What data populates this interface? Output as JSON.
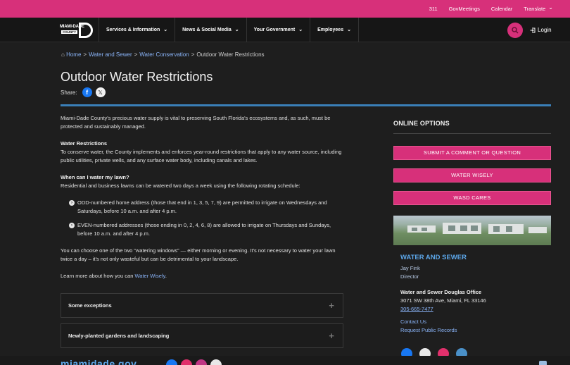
{
  "topbar": {
    "links": [
      "311",
      "GovMeetings",
      "Calendar",
      "Translate"
    ]
  },
  "navbar": {
    "logo_line1": "MIAMI-DADE",
    "logo_line2": "COUNTY",
    "items": [
      {
        "label": "Services & Information"
      },
      {
        "label": "News & Social Media"
      },
      {
        "label": "Your Government"
      },
      {
        "label": "Employees"
      }
    ],
    "login_label": "Login"
  },
  "breadcrumb": {
    "home": "Home",
    "water_and_sewer": "Water and Sewer",
    "water_conservation": "Water Conservation",
    "current": "Outdoor Water Restrictions",
    "separator": ">"
  },
  "page": {
    "title": "Outdoor Water Restrictions",
    "share_label": "Share:"
  },
  "content": {
    "intro": "Miami-Dade County's precious water supply is vital to preserving South Florida's ecosystems and, as such, must be protected and sustainably managed.",
    "restrictions_heading": "Water Restrictions",
    "restrictions_body": "To conserve water, the County implements and enforces year-round restrictions that apply to any water source, including public utilities, private wells, and any surface water body, including canals and lakes.",
    "lawn_heading": "When can I water my lawn?",
    "lawn_body": "Residential and business lawns can be watered two days a week using the following rotating schedule:",
    "bullets": [
      "ODD-numbered home address (those that end in 1, 3, 5, 7, 9) are permitted to irrigate on Wednesdays and Saturdays, before 10 a.m. and after 4 p.m.",
      "EVEN-numbered addresses (those ending in 0, 2, 4, 6, 8) are allowed to irrigate on Thursdays and Sundays, before 10 a.m. and after 4 p.m."
    ],
    "windows_text": "You can choose one of the two “watering windows” — either morning or evening. It's not necessary to water your lawn twice a day – it's not only wasteful but can be detrimental to your landscape.",
    "learn_more_prefix": "Learn more about how you can ",
    "learn_more_link": "Water Wisely",
    "learn_more_suffix": "."
  },
  "accordions": [
    {
      "label": "Some exceptions"
    },
    {
      "label": "Newly-planted gardens and landscaping"
    }
  ],
  "sidebar": {
    "heading": "ONLINE OPTIONS",
    "buttons": [
      "SUBMIT A COMMENT OR QUESTION",
      "WATER WISELY",
      "WASD CARES"
    ],
    "department": "WATER AND SEWER",
    "director_name": "Jay Fink",
    "director_title": "Director",
    "office_name": "Water and Sewer Douglas Office",
    "address": "3071 SW 38th Ave, Miami, FL 33146",
    "phone": "305-665-7477",
    "contact_us": "Contact Us",
    "public_records": "Request Public Records"
  },
  "footer": {
    "logo_text": "miamidade.gov"
  },
  "colors": {
    "brand_pink": "#d7307a",
    "link_blue": "#8ab4f8",
    "heading_blue": "#5ca6e8",
    "rule_blue": "#3a7fb8",
    "background": "#1e1e1e"
  }
}
